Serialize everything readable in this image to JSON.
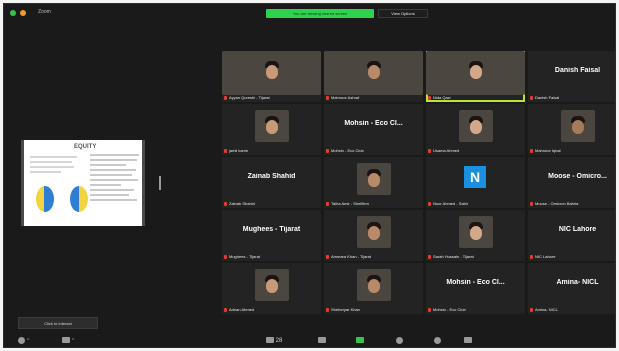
{
  "window": {
    "title": "Zoom"
  },
  "banner": {
    "sharing_text": "You are viewing shared screen",
    "view_options": "View Options"
  },
  "shared_screen": {
    "slide_title": "EQUITY"
  },
  "participants": [
    {
      "label": "Ayyan Qureshi - Tijarat",
      "type": "video"
    },
    {
      "label": "Mahnoor Ashraf",
      "type": "video"
    },
    {
      "label": "Nida Qazi",
      "type": "video",
      "active": true
    },
    {
      "name": "Danish Faisal",
      "label": "Danish Faisal",
      "type": "name"
    },
    {
      "label": "jamil karim",
      "type": "video"
    },
    {
      "name": "Mohsin - Eco Cl...",
      "label": "Mohsin - Eco Club",
      "type": "name"
    },
    {
      "label": "Usama Ahmed",
      "type": "video"
    },
    {
      "label": "Mahnoor Iqbal",
      "type": "video"
    },
    {
      "name": "Zainab Shahid",
      "label": "Zainab Shahid",
      "type": "name"
    },
    {
      "label": "Talha Amir - Shellfirm",
      "type": "video"
    },
    {
      "name": "N",
      "label": "Noor Ahmed - Sabir",
      "type": "avatar"
    },
    {
      "name": "Moose - Omicro...",
      "label": "Moose - Omicron Bahria",
      "type": "name"
    },
    {
      "name": "Mughees - Tijarat",
      "label": "Mughees - Tijarat",
      "type": "name"
    },
    {
      "label": "Ammara Khan - Tijarat",
      "type": "video"
    },
    {
      "label": "Sarah Hussain - Tijarat",
      "type": "video"
    },
    {
      "name": "NIC Lahore",
      "label": "NIC Lahore",
      "type": "name"
    },
    {
      "label": "Adnan Ahmed",
      "type": "video"
    },
    {
      "label": "Sheheryar Khan",
      "type": "video"
    },
    {
      "name": "Mohsin - Eco Cl...",
      "label": "Mohsin - Eco Club",
      "type": "name"
    },
    {
      "name": "Amina- NICL",
      "label": "Amina- NICL",
      "type": "name"
    }
  ],
  "bottom": {
    "user_chip": "Click to Interact",
    "participants_count": "28"
  }
}
